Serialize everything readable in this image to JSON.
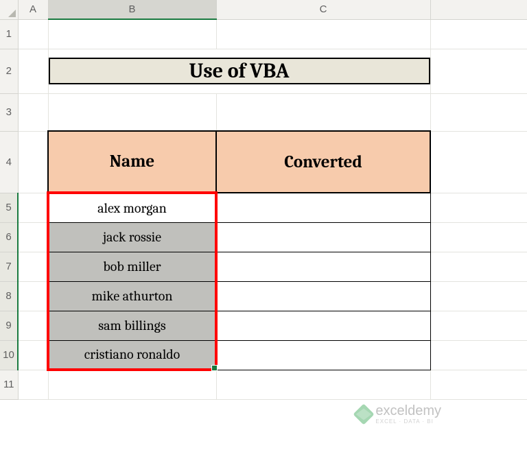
{
  "columns": {
    "a": "A",
    "b": "B",
    "c": "C"
  },
  "rows": [
    "1",
    "2",
    "3",
    "4",
    "5",
    "6",
    "7",
    "8",
    "9",
    "10",
    "11"
  ],
  "title": "Use of VBA",
  "table": {
    "headers": {
      "name": "Name",
      "converted": "Converted"
    },
    "data": [
      {
        "name": "alex morgan",
        "converted": ""
      },
      {
        "name": "jack rossie",
        "converted": ""
      },
      {
        "name": "bob miller",
        "converted": ""
      },
      {
        "name": "mike athurton",
        "converted": ""
      },
      {
        "name": "sam billings",
        "converted": ""
      },
      {
        "name": "cristiano ronaldo",
        "converted": ""
      }
    ]
  },
  "selection": {
    "range": "B5:B10",
    "active": "B5"
  },
  "watermark": {
    "text": "exceldemy",
    "sub": "EXCEL · DATA · BI"
  }
}
